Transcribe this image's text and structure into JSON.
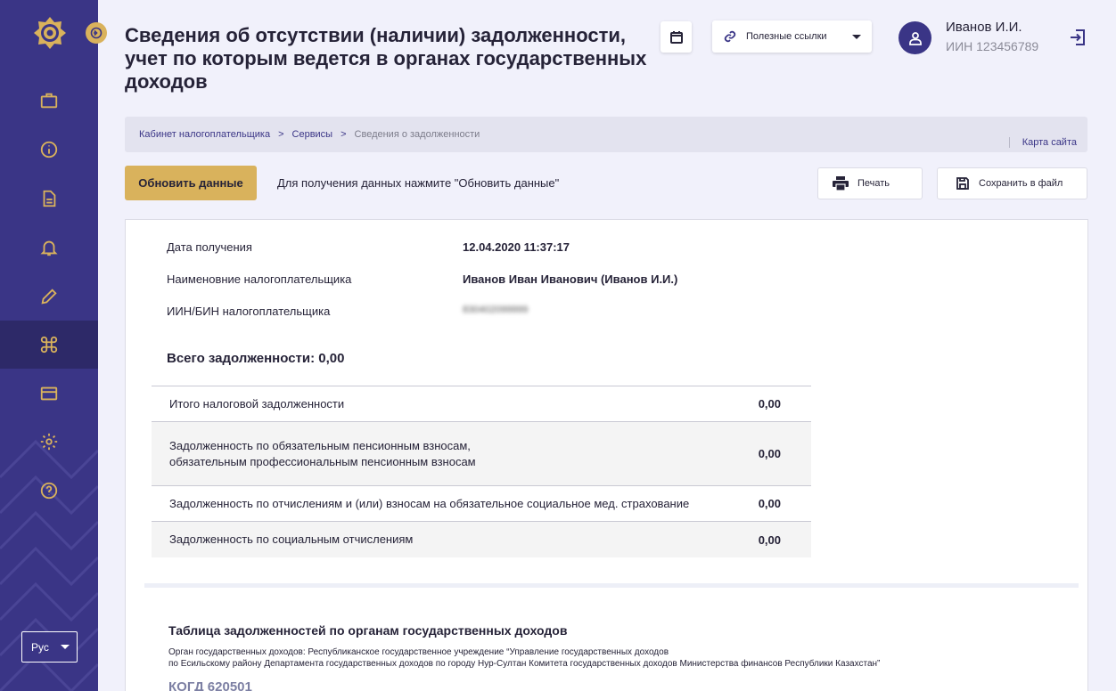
{
  "header": {
    "title": "Сведения об отсутствии (наличии) задолженности, учет по которым ведется в органах государственных доходов",
    "links_label": "Полезные ссылки",
    "user_name": "Иванов И.И.",
    "user_iin": "ИИН 123456789"
  },
  "breadcrumb": {
    "items": [
      "Кабинет налогоплательщика",
      "Сервисы",
      "Сведения о задолженности"
    ],
    "separator": ">",
    "sitemap": "Карта сайта"
  },
  "toolbar": {
    "refresh_label": "Обновить данные",
    "hint": "Для получения данных нажмите \"Обновить данные\"",
    "print_label": "Печать",
    "save_label": "Сохранить в файл"
  },
  "info": {
    "date_label": "Дата получения",
    "date_value": "12.04.2020  11:37:17",
    "name_label": "Наименовние налогоплательщика",
    "name_value": "Иванов Иван Иванович (Иванов И.И.)",
    "iin_label": "ИИН/БИН налогоплательщика",
    "iin_value": "830402099999"
  },
  "total": "Всего задолженности: 0,00",
  "debts": [
    {
      "label": "Итого  налоговой задолженности",
      "value": "0,00"
    },
    {
      "label": "Задолженность по обязательным пенсионным взносам,\nобязательным профессиональным пенсионным взносам",
      "value": "0,00"
    },
    {
      "label": "Задолженность по отчислениям и (или) взносам на обязательное социальное мед. страхование",
      "value": "0,00"
    },
    {
      "label": "Задолженность по социальным отчислениям",
      "value": "0,00"
    }
  ],
  "section": {
    "title": "Таблица задолженностей по органам государственных доходов",
    "org_line1": "Орган государственных доходов: Республиканское государственное учреждение “Управление государственных доходов",
    "org_line2": "по Есильскому району Департамента государственных доходов по городу Нур-Султан Комитета государственных доходов Министерства финансов Республики Казахстан”",
    "kogd": "КОГД 620501"
  },
  "sidebar": {
    "lang": "Рус",
    "icons": [
      "briefcase-icon",
      "info-icon",
      "document-icon",
      "bell-icon",
      "pencil-icon",
      "command-icon",
      "card-icon",
      "gear-icon",
      "help-icon"
    ],
    "active_index": 5
  },
  "colors": {
    "sidebar": "#3a3586",
    "sidebar_active": "#2d2968",
    "accent_gold": "#d9b25c",
    "page_bg": "#f1f1fb"
  }
}
